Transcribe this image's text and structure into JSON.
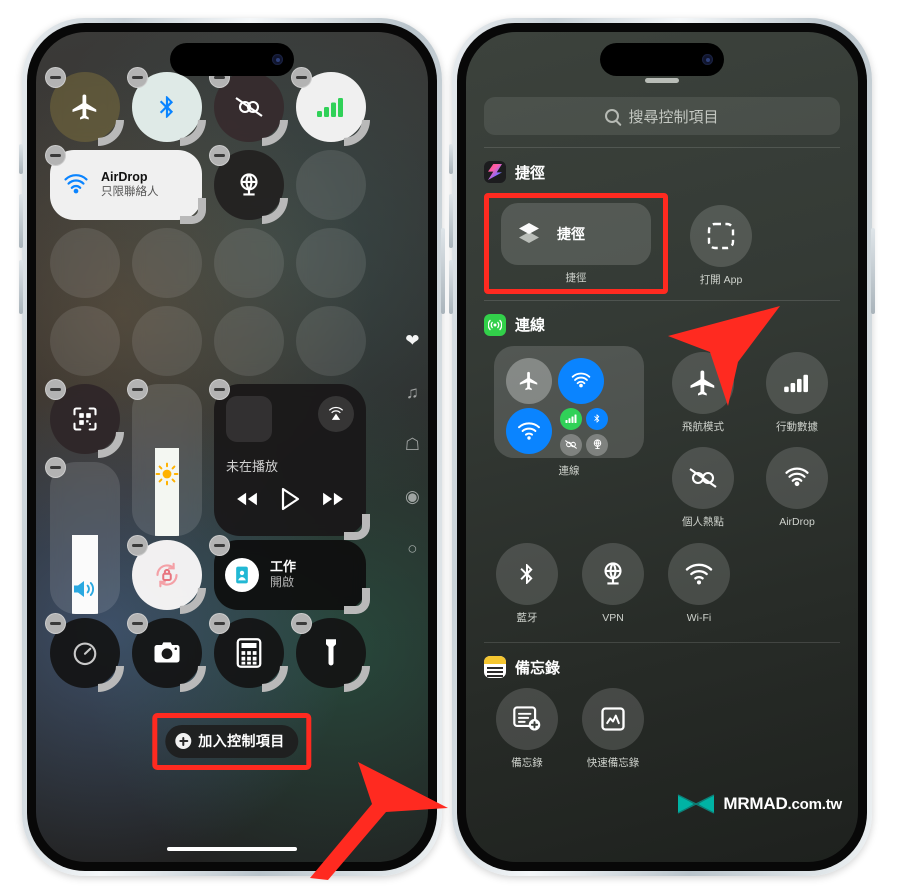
{
  "left_phone": {
    "name": "iPhone control centre edit mode",
    "page_indicators": [
      "heart-icon",
      "music-note-icon",
      "home-icon",
      "connectivity-icon",
      "circle-icon"
    ],
    "controls": [
      {
        "id": "airplane-mode",
        "icon": "airplane-icon",
        "label": "",
        "state": "off"
      },
      {
        "id": "bluetooth",
        "icon": "bluetooth-icon",
        "label": "",
        "state": "on"
      },
      {
        "id": "personal-hotspot",
        "icon": "hotspot-off-icon",
        "label": "",
        "state": "off"
      },
      {
        "id": "cellular-data",
        "icon": "cellular-bars-icon",
        "label": "",
        "state": "on"
      },
      {
        "id": "airdrop",
        "icon": "airdrop-icon",
        "title": "AirDrop",
        "subtitle": "只限聯絡人",
        "state": "on"
      },
      {
        "id": "vpn",
        "icon": "vpn-globe-icon",
        "label": "",
        "state": "off"
      },
      {
        "id": "scan-code",
        "icon": "qr-scan-icon",
        "label": ""
      },
      {
        "id": "brightness",
        "icon": "brightness-sun-icon",
        "label": ""
      },
      {
        "id": "volume",
        "icon": "volume-speaker-icon",
        "label": ""
      },
      {
        "id": "rotation-lock",
        "icon": "rotation-lock-icon",
        "label": ""
      },
      {
        "id": "focus-work",
        "icon": "focus-work-icon",
        "title": "工作",
        "subtitle": "開啟"
      },
      {
        "id": "timer",
        "icon": "timer-icon",
        "label": ""
      },
      {
        "id": "camera",
        "icon": "camera-icon",
        "label": ""
      },
      {
        "id": "calculator",
        "icon": "calculator-icon",
        "label": ""
      },
      {
        "id": "flashlight",
        "icon": "flashlight-icon",
        "label": ""
      }
    ],
    "media": {
      "status": "未在播放",
      "airplay_icon": "airplay-icon",
      "prev": "rewind-icon",
      "play": "play-icon",
      "next": "forward-icon"
    },
    "add_control": {
      "label": "加入控制項目",
      "icon": "plus-circle-icon",
      "highlight_color": "#ff2a20"
    }
  },
  "right_phone": {
    "name": "Add a control gallery",
    "search": {
      "placeholder": "搜尋控制項目",
      "icon": "search-icon"
    },
    "groups": [
      {
        "id": "shortcuts",
        "title": "捷徑",
        "icon": "shortcuts-app-icon",
        "items": [
          {
            "id": "shortcut",
            "label": "捷徑",
            "icon": "shortcut-layers-icon",
            "highlighted": true
          },
          {
            "id": "open-app",
            "label": "打開 App",
            "icon": "open-app-dashed-icon",
            "highlighted": false
          }
        ]
      },
      {
        "id": "connectivity",
        "title": "連線",
        "icon": "connectivity-app-icon",
        "items": [
          {
            "id": "connectivity-group",
            "label": "連線",
            "icon": "connectivity-cluster-icon",
            "highlighted": false
          },
          {
            "id": "airplane-mode",
            "label": "飛航模式",
            "icon": "airplane-icon",
            "highlighted": false
          },
          {
            "id": "cellular-data",
            "label": "行動數據",
            "icon": "cellular-bars-icon",
            "highlighted": false
          },
          {
            "id": "personal-hotspot",
            "label": "個人熱點",
            "icon": "hotspot-off-icon",
            "highlighted": false
          },
          {
            "id": "airdrop",
            "label": "AirDrop",
            "icon": "airdrop-icon",
            "highlighted": false
          },
          {
            "id": "bluetooth",
            "label": "藍牙",
            "icon": "bluetooth-icon",
            "highlighted": false
          },
          {
            "id": "vpn",
            "label": "VPN",
            "icon": "vpn-globe-icon",
            "highlighted": false
          },
          {
            "id": "wifi",
            "label": "Wi-Fi",
            "icon": "wifi-icon",
            "highlighted": false
          }
        ]
      },
      {
        "id": "notes",
        "title": "備忘錄",
        "icon": "notes-app-icon",
        "items": [
          {
            "id": "notes",
            "label": "備忘錄",
            "icon": "note-new-icon",
            "highlighted": false
          },
          {
            "id": "quick-note",
            "label": "快速備忘錄",
            "icon": "quick-note-icon",
            "highlighted": false
          }
        ]
      }
    ],
    "highlight_color": "#ff2a20"
  },
  "watermark": {
    "brand": "MRMAD",
    "domain": ".com.tw",
    "logo_color": "#00b3a4"
  },
  "annotations": {
    "arrow_color": "#ff2a20",
    "arrow_count": 2
  }
}
